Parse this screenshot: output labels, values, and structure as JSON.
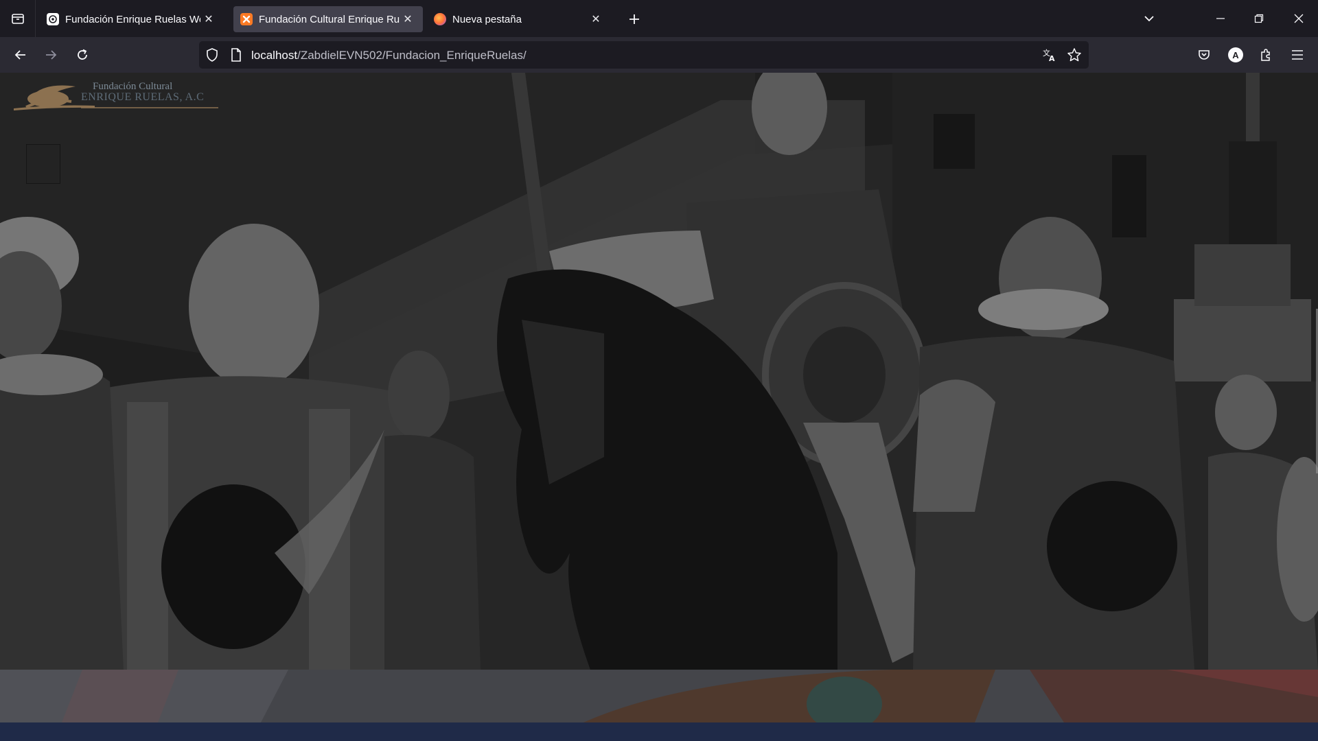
{
  "browser": {
    "tabs": [
      {
        "title": "Fundación Enrique Ruelas Web",
        "favicon": "chatgpt-icon",
        "active": false
      },
      {
        "title": "Fundación Cultural Enrique Ruelas",
        "favicon": "xampp-icon",
        "active": true
      },
      {
        "title": "Nueva pestaña",
        "favicon": "firefox-icon",
        "active": false
      }
    ],
    "url": {
      "host": "localhost",
      "path": "/ZabdielEVN502/Fundacion_EnriqueRuelas/"
    },
    "profile_initial": "A",
    "colors": {
      "tab_bar": "#1c1b22",
      "nav_bar": "#2b2a33",
      "active_tab": "#42414d",
      "url_bg": "#1c1b22"
    }
  },
  "site": {
    "logo": {
      "line1": "Fundación Cultural",
      "line2": "ENRIQUE RUELAS, A.C",
      "color": "#8c7150"
    },
    "menu_icon": "hamburger-icon",
    "colors": {
      "bottom_bar": "#1f2a48"
    }
  }
}
